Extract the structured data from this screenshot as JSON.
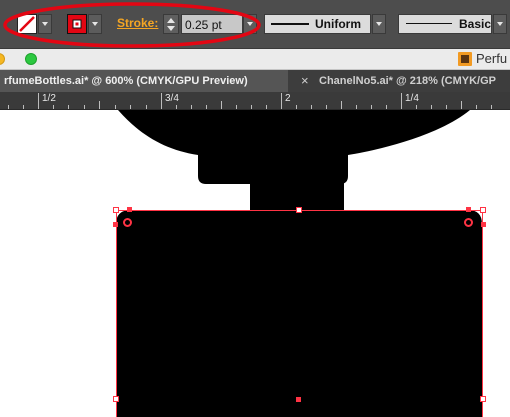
{
  "control_bar": {
    "stroke_label": "Stroke:",
    "stroke_weight": "0.25 pt",
    "variable_width_profile": "Uniform",
    "brush_definition": "Basic"
  },
  "document": {
    "window_title": "Perfu",
    "tabs": [
      {
        "label": "rfumeBottles.ai* @ 600% (CMYK/GPU Preview)",
        "active": true
      },
      {
        "label": "ChanelNo5.ai* @ 218% (CMYK/GP",
        "active": false
      }
    ],
    "tab_close_glyph": "×",
    "ruler_labels": [
      "1/2",
      "3/4",
      "2",
      "1/4"
    ]
  },
  "colors": {
    "control_bar_bg": "#4d4d4d",
    "stroke_label": "#f5a623",
    "annotation_circle": "#e30613",
    "selection": "#ff3344",
    "shape_fill": "#000000"
  },
  "icons": {
    "fill_swatch": "no-fill-swatch-icon",
    "stroke_swatch": "stroke-swatch-icon",
    "close_window": "close-window-icon",
    "zoom_window": "zoom-window-icon",
    "document": "ai-document-icon"
  }
}
